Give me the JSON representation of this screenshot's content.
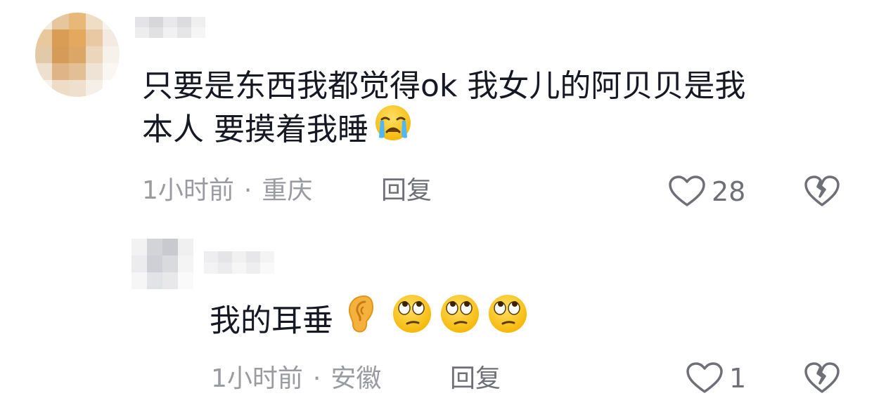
{
  "comments": [
    {
      "text_line1": "只要是东西我都觉得ok 我女儿的阿贝贝是我",
      "text_line2": "本人 要摸着我睡",
      "emoji": "crying-face-icon",
      "time": "1小时前",
      "separator": "·",
      "location": "重庆",
      "reply_label": "回复",
      "like_count": "28"
    },
    {
      "text": "我的耳垂",
      "emojis": [
        "ear-icon",
        "eye-roll-face-icon",
        "eye-roll-face-icon",
        "eye-roll-face-icon"
      ],
      "time": "1小时前",
      "separator": "·",
      "location": "安徽",
      "reply_label": "回复",
      "like_count": "1"
    }
  ],
  "colors": {
    "text": "#161823",
    "meta": "#9a9ba1",
    "action": "#6f7077"
  }
}
